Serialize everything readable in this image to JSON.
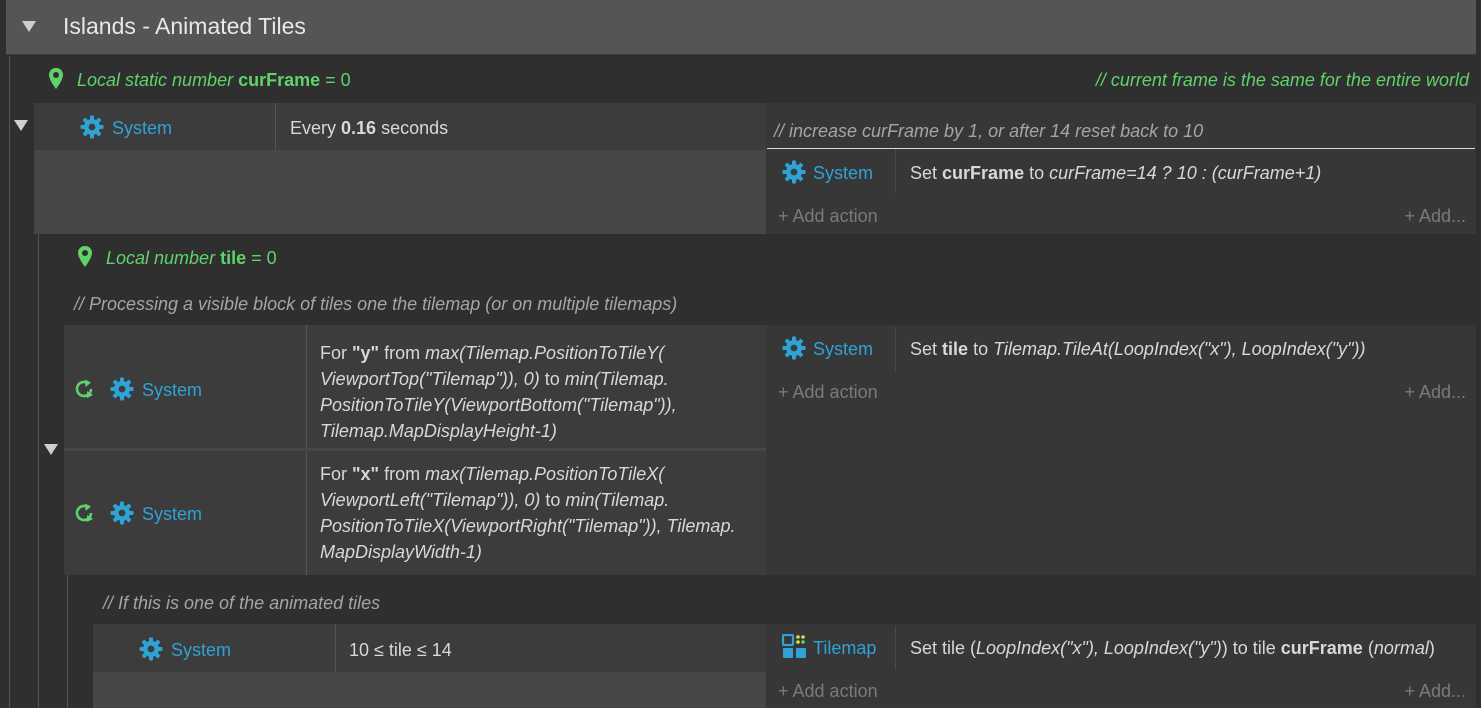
{
  "group": {
    "title": "Islands - Animated Tiles"
  },
  "var1": {
    "prefix": "Local static number",
    "name": "curFrame",
    "suffix": "= 0"
  },
  "comment_world": "//  current frame is the same for the entire world",
  "event1": {
    "object": "System",
    "cond_pre": "Every",
    "cond_val": "0.16",
    "cond_post": "seconds",
    "comment": "//  increase curFrame by 1, or after 14 reset back to 10",
    "action_object": "System",
    "action_set": "Set",
    "action_var": "curFrame",
    "action_to": "to",
    "action_expr": "curFrame=14 ? 10 : (curFrame+1)",
    "add_action": "Add action",
    "add_more": "Add..."
  },
  "var2": {
    "prefix": "Local number",
    "name": "tile",
    "suffix": "= 0"
  },
  "comment_processing": "//  Processing a visible block of tiles one the tilemap (or on multiple tilemaps)",
  "event2": {
    "cond1_object": "System",
    "cond1_for": "For",
    "cond1_var": "\"y\"",
    "cond1_from": "from",
    "cond1_l1": "max(Tilemap.PositionToTileY(",
    "cond1_l2a": "ViewportTop(\"Tilemap\")), 0)",
    "cond1_l2to": "to",
    "cond1_l2b": "min(Tilemap.",
    "cond1_l3": "PositionToTileY(ViewportBottom(\"Tilemap\")),",
    "cond1_l4": "Tilemap.MapDisplayHeight-1)",
    "cond2_object": "System",
    "cond2_for": "For",
    "cond2_var": "\"x\"",
    "cond2_from": "from",
    "cond2_l1": "max(Tilemap.PositionToTileX(",
    "cond2_l2a": "ViewportLeft(\"Tilemap\")), 0)",
    "cond2_l2to": "to",
    "cond2_l2b": "min(Tilemap.",
    "cond2_l3": "PositionToTileX(ViewportRight(\"Tilemap\")), Tilemap.",
    "cond2_l4": "MapDisplayWidth-1)",
    "action_object": "System",
    "action_set": "Set",
    "action_var": "tile",
    "action_to": "to",
    "action_expr": "Tilemap.TileAt(LoopIndex(\"x\"), LoopIndex(\"y\"))",
    "add_action": "Add action",
    "add_more": "Add..."
  },
  "comment_animated": "//  If this is one of the animated tiles",
  "event3": {
    "object": "System",
    "condition": "10 ≤ tile ≤ 14",
    "action_object": "Tilemap",
    "action_pre": "Set tile (",
    "action_args": "LoopIndex(\"x\"), LoopIndex(\"y\")",
    "action_mid": ") to tile",
    "action_var": "curFrame",
    "action_paren_open": "(",
    "action_mode": "normal",
    "action_paren_close": ")",
    "add_action": "Add action",
    "add_more": "Add..."
  },
  "colors": {
    "green": "#5fd36a",
    "system_blue": "#2ea3d6",
    "background": "#2f2f2f"
  }
}
